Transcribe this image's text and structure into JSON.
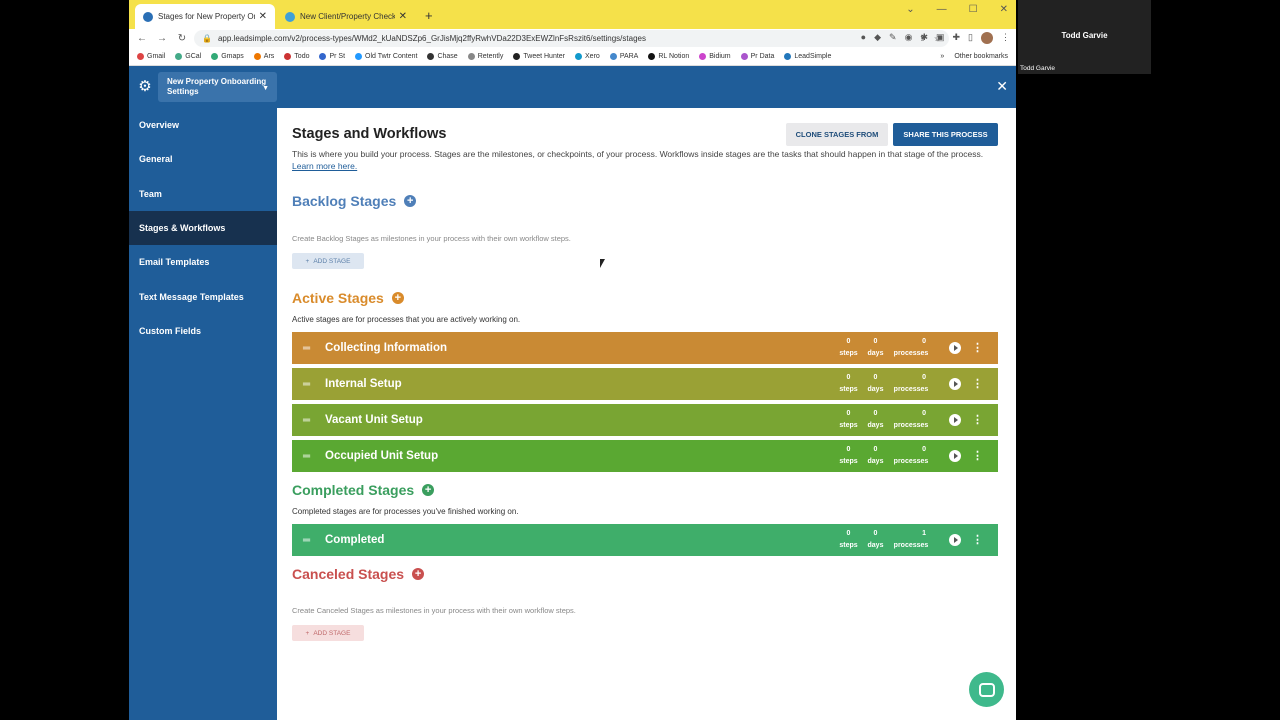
{
  "browser": {
    "tabs": [
      {
        "title": "Stages for New Property Onboard",
        "active": true
      },
      {
        "title": "New Client/Property Checklist | P",
        "active": false
      }
    ],
    "url": "app.leadsimple.com/v2/process-types/WMd2_kUaNDSZp6_GrJisMjq2ffyRwhVDa22D3ExEWZlnFsRszit6/settings/stages",
    "bookmarks": [
      "Gmail",
      "GCal",
      "Gmaps",
      "Ars",
      "Todo",
      "Pr St",
      "Old Twtr Content",
      "Chase",
      "Retently",
      "Tweet Hunter",
      "Xero",
      "PARA",
      "RL Notion",
      "Bidium",
      "Pr Data",
      "LeadSimple"
    ],
    "bookmarks_more": "»",
    "other_bookmarks": "Other bookmarks",
    "colors": {
      "tabbar": "#f5e14a"
    }
  },
  "header": {
    "process_name": "New Property Onboarding Settings"
  },
  "sidebar": {
    "items": [
      {
        "label": "Overview",
        "active": false
      },
      {
        "label": "General",
        "active": false
      },
      {
        "label": "Team",
        "active": false
      },
      {
        "label": "Stages & Workflows",
        "active": true
      },
      {
        "label": "Email Templates",
        "active": false
      },
      {
        "label": "Text Message Templates",
        "active": false
      },
      {
        "label": "Custom Fields",
        "active": false
      }
    ]
  },
  "main": {
    "title": "Stages and Workflows",
    "clone_label": "CLONE STAGES FROM",
    "share_label": "SHARE THIS PROCESS",
    "description": "This is where you build your process. Stages are the milestones, or checkpoints, of your process. Workflows inside stages are the tasks that should happen in that stage of the process.",
    "learn_more": "Learn more here.",
    "backlog": {
      "title": "Backlog Stages",
      "desc": "Create Backlog Stages as milestones in your process with their own workflow steps.",
      "add_label": "ADD STAGE",
      "color": "#4f7fb8"
    },
    "active": {
      "title": "Active Stages",
      "desc": "Active stages are for processes that you are actively working on.",
      "color": "#d98b2b",
      "stages": [
        {
          "name": "Collecting Information",
          "steps": "0",
          "days": "0",
          "processes": "0",
          "color": "#c98a34"
        },
        {
          "name": "Internal Setup",
          "steps": "0",
          "days": "0",
          "processes": "0",
          "color": "#9aa135"
        },
        {
          "name": "Vacant Unit Setup",
          "steps": "0",
          "days": "0",
          "processes": "0",
          "color": "#79a533"
        },
        {
          "name": "Occupied Unit Setup",
          "steps": "0",
          "days": "0",
          "processes": "0",
          "color": "#5aa832"
        }
      ]
    },
    "completed": {
      "title": "Completed Stages",
      "desc": "Completed stages are for processes you've finished working on.",
      "color": "#3a9e5e",
      "stages": [
        {
          "name": "Completed",
          "steps": "0",
          "days": "0",
          "processes": "1",
          "color": "#3fae6a"
        }
      ]
    },
    "canceled": {
      "title": "Canceled Stages",
      "desc": "Create Canceled Stages as milestones in your process with their own workflow steps.",
      "add_label": "ADD STAGE",
      "color": "#c9504f"
    },
    "metric_labels": {
      "steps": "steps",
      "days": "days",
      "processes": "processes"
    }
  },
  "video_tile": {
    "name": "Todd Garvie",
    "tag": "Todd Garvie"
  }
}
